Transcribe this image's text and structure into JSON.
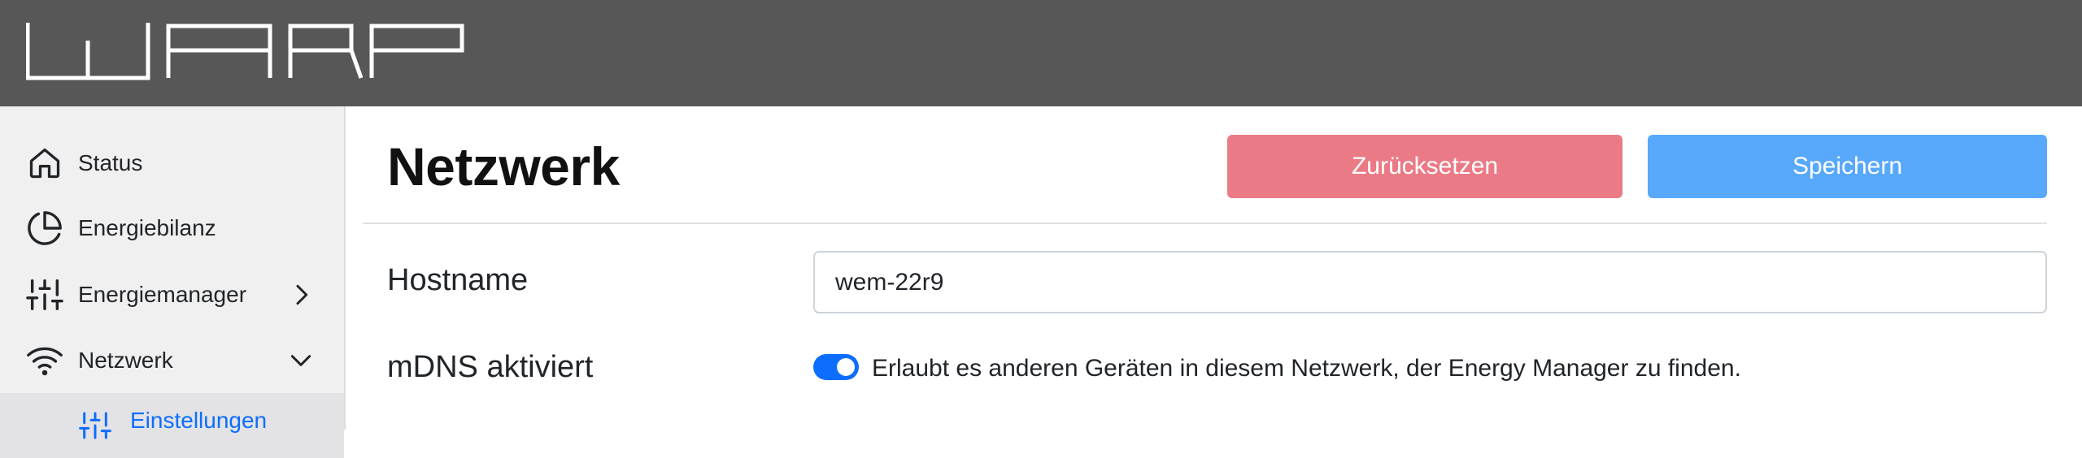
{
  "app": {
    "logo_text": "WARP",
    "accent_color": "#0d6efd",
    "header_color": "#575757"
  },
  "sidebar": {
    "items": [
      {
        "label": "Status",
        "icon": "home-icon"
      },
      {
        "label": "Energiebilanz",
        "icon": "pie-chart-icon"
      },
      {
        "label": "Energiemanager",
        "icon": "sliders-icon",
        "chevron": "chevron-right-icon"
      },
      {
        "label": "Netzwerk",
        "icon": "wifi-icon",
        "chevron": "chevron-down-icon"
      },
      {
        "label": "Einstellungen",
        "icon": "sliders-icon",
        "active": true
      }
    ]
  },
  "main": {
    "title": "Netzwerk",
    "reset_label": "Zurücksetzen",
    "save_label": "Speichern",
    "reset_color": "#ea7b86",
    "save_color": "#58a9fc",
    "hostname": {
      "label": "Hostname",
      "value": "wem-22r9"
    },
    "mdns": {
      "label": "mDNS aktiviert",
      "enabled": true,
      "description": "Erlaubt es anderen Geräten in diesem Netzwerk, der Energy Manager zu finden."
    }
  }
}
